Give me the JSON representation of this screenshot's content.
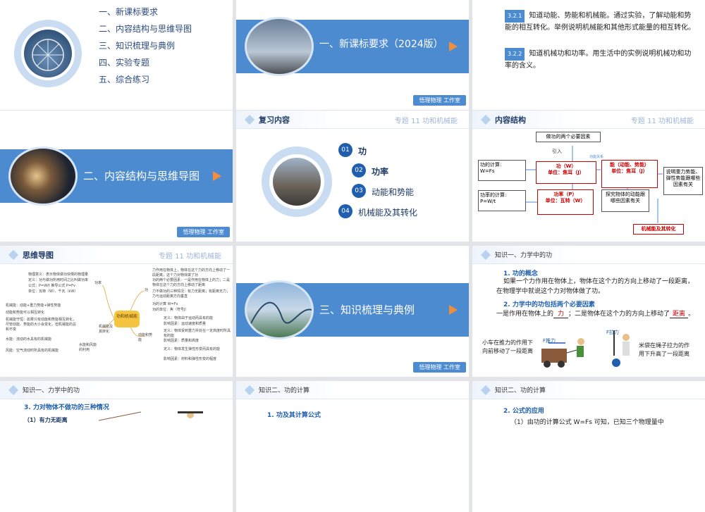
{
  "slide1": {
    "menu": [
      "一、新课标要求",
      "二、内容结构与思维导图",
      "三、知识梳理与典例",
      "四、实验专题",
      "五、综合练习"
    ]
  },
  "slide2": {
    "title": "一、新课标要求（2024版）",
    "stamp": "悟理物理 工作室"
  },
  "slide3": {
    "items": [
      {
        "code": "3.2.1",
        "text": "知道动能、势能和机械能。通过实验，了解动能和势能的相互转化。举例说明机械能和其他形式能量的相互转化。"
      },
      {
        "code": "3.2.2",
        "text": "知道机械功和功率。用生活中的实例说明机械功和功率的含义。"
      }
    ]
  },
  "slide4": {
    "title": "二、内容结构与思维导图",
    "stamp": "悟理物理 工作室"
  },
  "slide5": {
    "header": "复习内容",
    "subtitle": "专题 11 功和机械能",
    "items": [
      {
        "num": "01",
        "label": "功"
      },
      {
        "num": "02",
        "label": "功率"
      },
      {
        "num": "03",
        "label": "动能和势能"
      },
      {
        "num": "04",
        "label": "机械能及其转化"
      }
    ]
  },
  "slide6": {
    "header": "内容结构",
    "subtitle": "专题 11 功和机械能",
    "top": "做功的两个必要因素",
    "intro": "引入",
    "calc": "功的计算:",
    "calc_f": "W=Fs",
    "work": "功（W）",
    "work_u": "单位：焦耳（J）",
    "measure": "功能关系",
    "energy": "能（动能、势能）",
    "energy_u": "单位：焦耳（J）",
    "explain": "说明重力势能、弹性势能跟哪些因素有关",
    "pcalc": "功率的计算:",
    "pcalc_f": "P=W/t",
    "power": "功率（P）",
    "power_u": "单位：瓦特（W）",
    "explore": "探究物体的动能跟哪些因素有关",
    "mech": "机械能及其转化"
  },
  "slide7": {
    "header": "思维导图",
    "subtitle": "专题 11 功和机械能",
    "center": "功和机械能",
    "branches": [
      "功",
      "功率",
      "动能和势能",
      "机械能及其转化"
    ],
    "leaves": [
      "物理意义：表示物体做功快慢的物理量",
      "定义：功与做功所用时间之比叫做功率",
      "公式：P=W/t  推导公式 P=Fv",
      "单位：瓦特（W）、千瓦（kW）",
      "力作用在物体上，物体在这个力的方向上移动了一段距离，这个力对物体做了功",
      "功的两个必要因素：一是作用在物体上的力；二是物体在这个力的方向上移动了距离",
      "力不做功的三种情况：有力无距离；有距离无力；力与运动距离方向垂直",
      "功的计算  W=Fs",
      "功的单位：焦（符号J）",
      "定义：物体由于运动而具有的能",
      "影响因素：运动速度和质量",
      "定义：物体受到重力并处在一定高度时所具有的能",
      "影响因素：质量和高度",
      "定义：物体发生弹性形变而具有的能",
      "影响因素：材料和弹性形变的程度",
      "机械能：动能+重力势能+弹性势能",
      "动能和势能可以相互转化",
      "机械能守恒：如果只有动能和势能相互转化，尽管动能、势能的大小会变化，但机械能的总和不变",
      "水能：流动的水具有的机械能",
      "水能和风能的利用",
      "风能：空气流动时所具有的机械能"
    ]
  },
  "slide8": {
    "title": "三、知识梳理与典例",
    "stamp": "悟理物理 工作室"
  },
  "slide9": {
    "header": "知识一、力学中的功",
    "h1": "1. 功的概念",
    "p1": "如果一个力作用在物体上，物体在这个力的方向上移动了一段距离，在物理学中就说这个力对物体做了功。",
    "h2": "2. 力学中的功包括两个必要因素",
    "p2a": "一是作用在物体上的",
    "blank1": "力",
    "p2b": "；二是物体在这个力的方向上移动了",
    "blank2": "距离",
    "cap1": "小车在推力的作用下向前移动了一段距离",
    "cap2": "米袋在绳子拉力的作用下升高了一段距离",
    "f1": "F推力",
    "f2": "F拉力"
  },
  "slide10": {
    "header": "知识一、力学中的功",
    "h1": "3. 力对物体不做功的三种情况",
    "sub": "（1）有力无距离"
  },
  "slide11": {
    "header": "知识二、功的计算",
    "h1": "1. 功及其计算公式"
  },
  "slide12": {
    "header": "知识二、功的计算",
    "h1": "2. 公式的应用",
    "p1": "（1）由功的计算公式 W=Fs 可知，已知三个物理量中"
  }
}
